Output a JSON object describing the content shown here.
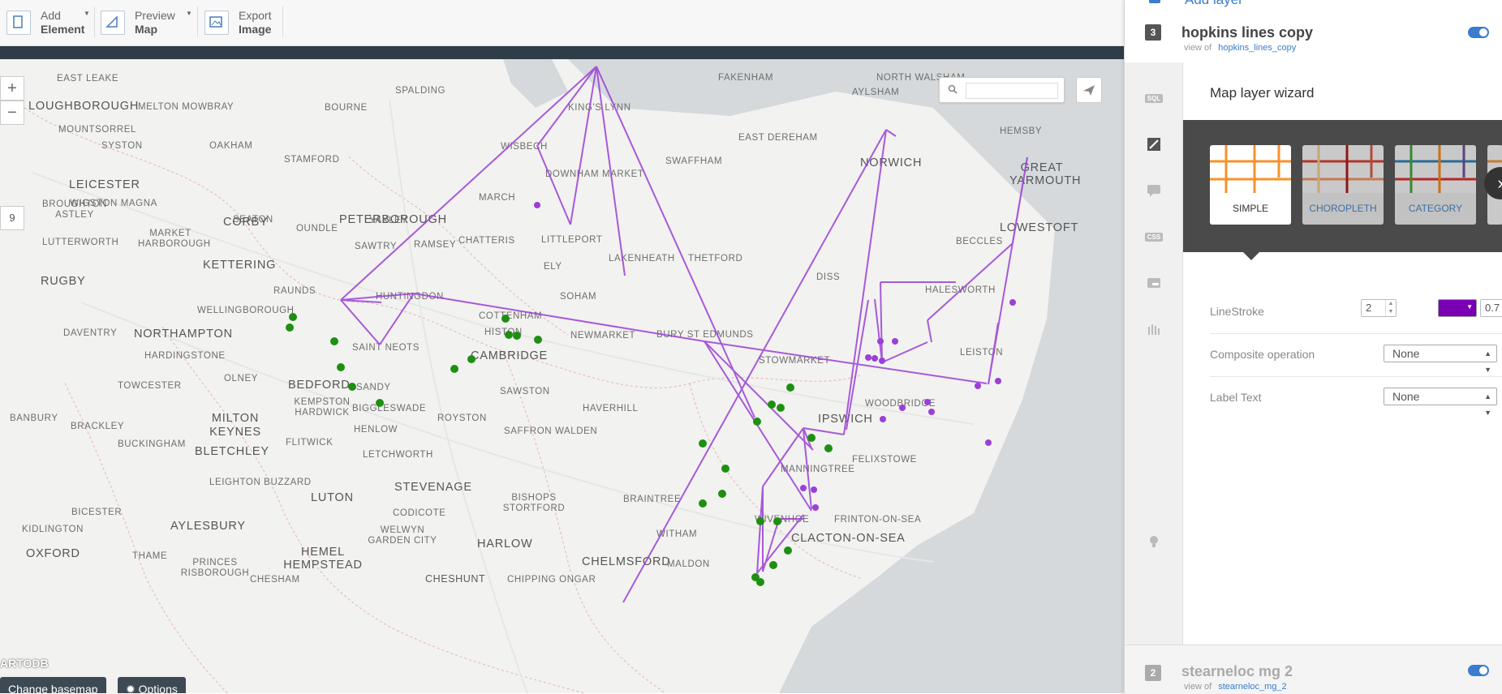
{
  "toolbar": {
    "add_element": {
      "line1": "Add",
      "line2": "Element"
    },
    "preview_map": {
      "line1": "Preview",
      "line2": "Map"
    },
    "export_image": {
      "line1": "Export",
      "line2": "Image"
    }
  },
  "map": {
    "zoom_in": "+",
    "zoom_out": "−",
    "zoom_level": "9",
    "search_placeholder": "",
    "attribution": "ARTODB",
    "change_basemap": "Change basemap",
    "options": "Options",
    "places": [
      "EAST LEAKE",
      "LOUGHBOROUGH",
      "MELTON MOWBRAY",
      "BOURNE",
      "SPALDING",
      "KING'S LYNN",
      "FAKENHAM",
      "NORTH WALSHAM",
      "AYLSHAM",
      "MOUNTSORREL",
      "SYSTON",
      "OAKHAM",
      "STAMFORD",
      "WISBECH",
      "DOWNHAM MARKET",
      "SWAFFHAM",
      "EAST DEREHAM",
      "NORWICH",
      "HEMSBY",
      "GREAT YARMOUTH",
      "LEICESTER",
      "WIGSTON MAGNA",
      "SEATON",
      "PETERBOROUGH",
      "MARCH",
      "BROUGHTON ASTLEY",
      "CORBY",
      "OUNDLE",
      "YAXLEY",
      "LOWESTOFT",
      "MARKET HARBOROUGH",
      "LUTTERWORTH",
      "SAWTRY",
      "RAMSEY",
      "CHATTERIS",
      "LITTLEPORT",
      "BECCLES",
      "KETTERING",
      "ELY",
      "LAKENHEATH",
      "THETFORD",
      "RUGBY",
      "RAUNDS",
      "HUNTINGDON",
      "SOHAM",
      "DISS",
      "HALESWORTH",
      "WELLINGBOROUGH",
      "COTTENHAM",
      "NORTHAMPTON",
      "DAVENTRY",
      "HISTON",
      "NEWMARKET",
      "BURY ST EDMUNDS",
      "SAINT NEOTS",
      "CAMBRIDGE",
      "STOWMARKET",
      "LEISTON",
      "HARDINGSTONE",
      "BEDFORD",
      "OLNEY",
      "TOWCESTER",
      "SANDY",
      "SAWSTON",
      "WOODBRIDGE",
      "KEMPSTON HARDWICK",
      "BIGGLESWADE",
      "HAVERHILL",
      "IPSWICH",
      "BANBURY",
      "BRACKLEY",
      "MILTON KEYNES",
      "ROYSTON",
      "HENLOW",
      "SAFFRON WALDEN",
      "BUCKINGHAM",
      "BLETCHLEY",
      "FLITWICK",
      "LETCHWORTH",
      "MANNINGTREE",
      "FELIXSTOWE",
      "LEIGHTON BUZZARD",
      "BICESTER",
      "LUTON",
      "STEVENAGE",
      "BISHOPS STORTFORD",
      "BRAINTREE",
      "WIVENHOE",
      "FRINTON-ON-SEA",
      "CODICOTE",
      "AYLESBURY",
      "KIDLINGTON",
      "WELWYN GARDEN CITY",
      "HARLOW",
      "WITHAM",
      "CLACTON-ON-SEA",
      "HEMEL HEMPSTEAD",
      "THAME",
      "OXFORD",
      "PRINCES RISBOROUGH",
      "CHELMSFORD",
      "CHESHUNT",
      "CHIPPING ONGAR",
      "MALDON",
      "CHESHAM"
    ]
  },
  "panel": {
    "add_layer": "Add layer",
    "layer3": {
      "number": "3",
      "title": "hopkins lines copy",
      "view_of_label": "view of",
      "view_of_link": "hopkins_lines_copy"
    },
    "layer2": {
      "number": "2",
      "title": "stearneloc mg 2",
      "view_of_label": "view of",
      "view_of_link": "stearneloc_mg_2"
    },
    "side_icons": [
      "sql-icon",
      "wizard-icon",
      "infowindow-icon",
      "css-icon",
      "legend-icon",
      "filters-icon",
      "tips-icon"
    ],
    "sql_label": "SQL",
    "css_label": "CSS",
    "wizard": {
      "title": "Map layer wizard",
      "styles": [
        "SIMPLE",
        "CHOROPLETH",
        "CATEGORY"
      ],
      "selected": "SIMPLE",
      "line_stroke": {
        "label": "LineStroke",
        "width": "2",
        "color": "#7b00b4",
        "opacity": "0.7"
      },
      "composite": {
        "label": "Composite operation",
        "value": "None"
      },
      "label_text": {
        "label": "Label Text",
        "value": "None"
      }
    }
  },
  "colors": {
    "accent": "#397dcc",
    "line": "#9b3fd6",
    "point": "#1f8f12",
    "dark_bar": "#2e3d47"
  }
}
